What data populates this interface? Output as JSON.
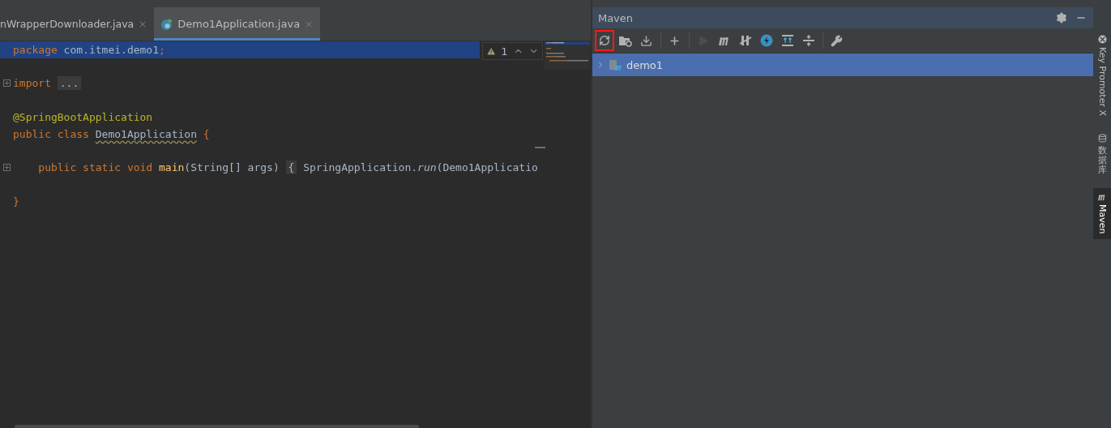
{
  "editor_tabs": [
    {
      "label": "nWrapperDownloader.java",
      "selected": false,
      "kind": "plain"
    },
    {
      "label": "Demo1Application.java",
      "selected": true,
      "kind": "spring"
    }
  ],
  "editor": {
    "lines": [
      {
        "selected": true,
        "fold": false,
        "tokens": [
          {
            "text": "package",
            "kind": "keyword"
          },
          {
            "text": " com.itmei.demo1",
            "kind": "plain"
          },
          {
            "text": ";",
            "kind": "keyword"
          }
        ]
      },
      {
        "selected": false,
        "fold": false
      },
      {
        "selected": false,
        "fold": true,
        "tokens": [
          {
            "text": "import ",
            "kind": "keyword"
          },
          {
            "text": "...",
            "kind": "folded"
          }
        ]
      },
      {
        "selected": false,
        "fold": false
      },
      {
        "selected": false,
        "fold": false,
        "tokens": [
          {
            "text": "@SpringBootApplication",
            "kind": "annotation"
          }
        ]
      },
      {
        "selected": false,
        "fold": false,
        "tokens": [
          {
            "text": "public class ",
            "kind": "keyword"
          },
          {
            "text": "Demo1Application",
            "kind": "warned"
          },
          {
            "text": " {",
            "kind": "keyword"
          }
        ]
      },
      {
        "selected": false,
        "fold": false
      },
      {
        "selected": false,
        "fold": true,
        "tokens": [
          {
            "text": "    public static void ",
            "kind": "keyword"
          },
          {
            "text": "main",
            "kind": "method"
          },
          {
            "text": "(String[] args) ",
            "kind": "plain"
          },
          {
            "text": "{",
            "kind": "folded"
          },
          {
            "text": " SpringApplication.",
            "kind": "plain"
          },
          {
            "text": "run",
            "kind": "italic"
          },
          {
            "text": "(Demo1Applicatio",
            "kind": "plain"
          }
        ]
      },
      {
        "selected": false,
        "fold": false
      },
      {
        "selected": false,
        "fold": false,
        "tokens": [
          {
            "text": "}",
            "kind": "keyword"
          }
        ]
      }
    ],
    "inspection": {
      "count": "1"
    }
  },
  "maven": {
    "title": "Maven",
    "toolbar": [
      {
        "kind": "refresh",
        "highlighted": true,
        "disabled": false
      },
      {
        "kind": "folder-sync",
        "highlighted": false,
        "disabled": false
      },
      {
        "kind": "download",
        "highlighted": false,
        "disabled": false
      },
      {
        "kind": "separator"
      },
      {
        "kind": "plus",
        "highlighted": false,
        "disabled": false
      },
      {
        "kind": "separator"
      },
      {
        "kind": "play",
        "highlighted": false,
        "disabled": true
      },
      {
        "kind": "maven",
        "highlighted": false,
        "disabled": false
      },
      {
        "kind": "skip",
        "highlighted": false,
        "disabled": false
      },
      {
        "kind": "bolt",
        "highlighted": false,
        "disabled": false
      },
      {
        "kind": "expand",
        "highlighted": false,
        "disabled": false
      },
      {
        "kind": "collapse",
        "highlighted": false,
        "disabled": false
      },
      {
        "kind": "separator"
      },
      {
        "kind": "wrench",
        "highlighted": false,
        "disabled": false
      }
    ],
    "tree": [
      {
        "label": "demo1",
        "selected": true,
        "expanded": false
      }
    ]
  },
  "side_tabs": [
    {
      "label": "Key Promoter X",
      "kind": "latin",
      "selected": false
    },
    {
      "label": "数据库",
      "kind": "cjk",
      "selected": false
    },
    {
      "label": "Maven",
      "kind": "latin",
      "selected": true
    }
  ]
}
